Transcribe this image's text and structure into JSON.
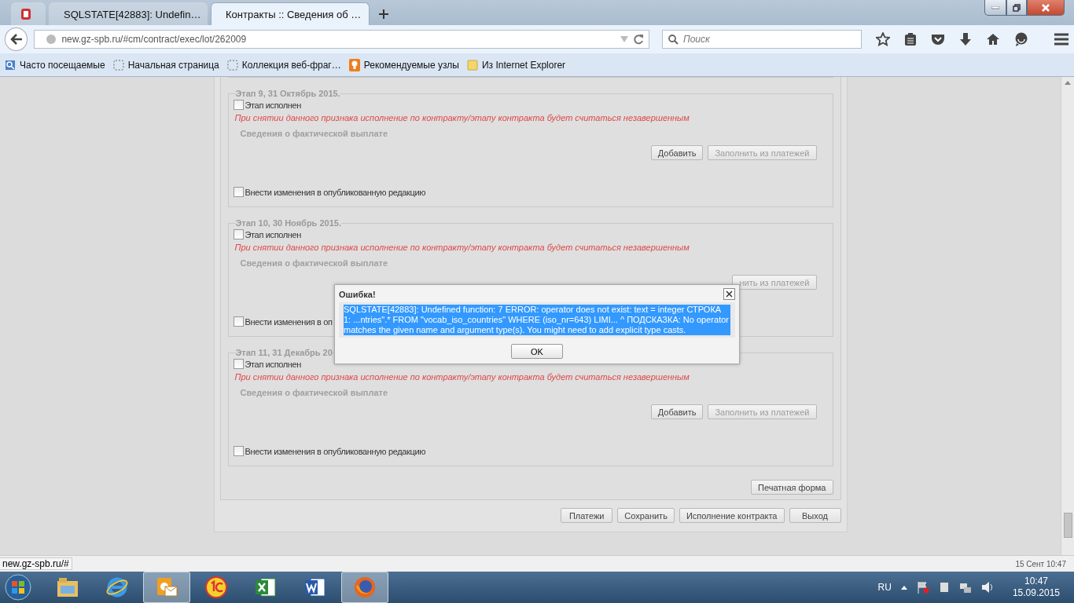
{
  "browser": {
    "tabs": [
      {
        "kind": "pinned",
        "selected": false
      },
      {
        "kind": "help",
        "title": "SQLSTATE[42883]: Undefin…",
        "selected": false
      },
      {
        "kind": "tool",
        "title": "Контракты :: Сведения об …",
        "selected": true
      }
    ],
    "address": "new.gz-spb.ru/#cm/contract/exec/lot/262009",
    "search": {
      "placeholder": "Поиск"
    },
    "bookmarks": [
      {
        "kind": "smart",
        "label": "Часто посещаемые"
      },
      {
        "kind": "blank",
        "label": "Начальная страница"
      },
      {
        "kind": "blank",
        "label": "Коллекция веб-фраг…"
      },
      {
        "kind": "suggested",
        "label": "Рекомендуемые узлы"
      },
      {
        "kind": "folder",
        "label": "Из Internet Explorer"
      }
    ]
  },
  "stages": [
    {
      "title": "Этап 9, 31 Октябрь 2015.",
      "done_label": "Этап исполнен",
      "done": false,
      "warning": "При снятии данного признака исполнение по контракту/этапу контракта будет считаться незавершенным",
      "payments_label": "Сведения о фактической выплате",
      "buttons": [
        {
          "label": "Добавить",
          "disabled": false
        },
        {
          "label": "Заполнить из платежей",
          "disabled": true
        }
      ],
      "amend_label": "Внести изменения в опубликованную редакцию",
      "amend": false
    },
    {
      "title": "Этап 10, 30 Ноябрь 2015.",
      "done_label": "Этап исполнен",
      "done": false,
      "warning": "При снятии данного признака исполнение по контракту/этапу контракта будет считаться незавершенным",
      "payments_label": "Сведения о фактической выплате",
      "buttons": [
        {
          "label": "нить из платежей",
          "disabled": true
        }
      ],
      "amend_label": "Внести изменения в оп",
      "amend": false
    },
    {
      "title": "Этап 11, 31 Декабрь 20",
      "done_label": "Этап исполнен",
      "done": false,
      "warning": "При снятии данного признака исполнение по контракту/этапу контракта будет считаться незавершенным",
      "payments_label": "Сведения о фактической выплате",
      "buttons": [
        {
          "label": "Добавить",
          "disabled": false
        },
        {
          "label": "Заполнить из платежей",
          "disabled": true
        }
      ],
      "amend_label": "Внести изменения в опубликованную редакцию",
      "amend": false
    }
  ],
  "print_button": "Печатная форма",
  "actions": [
    "Платежи",
    "Сохранить",
    "Исполнение контракта",
    "Выход"
  ],
  "dialog": {
    "title": "Ошибка!",
    "message": {
      "text": "SQLSTATE[42883]: Undefined function: 7 ERROR: operator does not exist: text = integer СТРОКА 1: ...ntries\".* FROM \"vocab_iso_countries\" WHERE (iso_nr=643) LIMI... ^ ПОДСКАЗКА: No operator matches the given name and argument type(s). You might need to add explicit type casts.",
      "selected": true
    },
    "ok": "OK"
  },
  "status_bar": {
    "url": "new.gz-spb.ru/#",
    "timestamp": "15 Сент 10:47"
  },
  "taskbar": {
    "apps": [
      {
        "kind": "explorer",
        "active": false
      },
      {
        "kind": "ie",
        "active": false
      },
      {
        "kind": "outlook",
        "active": true
      },
      {
        "kind": "onec",
        "active": false
      },
      {
        "kind": "excel",
        "active": false
      },
      {
        "kind": "word",
        "active": false
      },
      {
        "kind": "firefox",
        "active": true
      }
    ],
    "language": "RU",
    "time": "10:47",
    "date": "15.09.2015"
  }
}
